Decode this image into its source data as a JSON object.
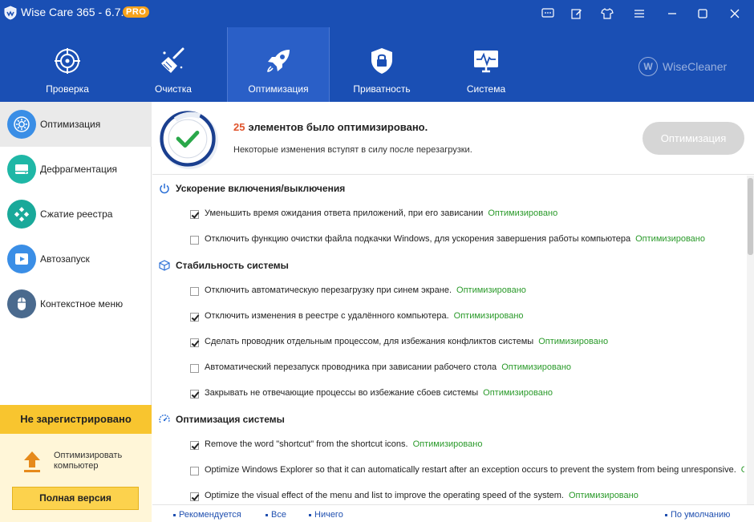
{
  "titlebar": {
    "title": "Wise Care 365 - 6.7.2",
    "badge": "PRO",
    "icons": [
      "feedback-icon",
      "edit-icon",
      "skin-icon",
      "menu-icon",
      "minimize-icon",
      "maximize-icon",
      "close-icon"
    ]
  },
  "nav": {
    "items": [
      {
        "label": "Проверка",
        "icon": "target-icon"
      },
      {
        "label": "Очистка",
        "icon": "broom-icon"
      },
      {
        "label": "Оптимизация",
        "icon": "rocket-icon",
        "active": true
      },
      {
        "label": "Приватность",
        "icon": "shield-lock-icon"
      },
      {
        "label": "Система",
        "icon": "monitor-pulse-icon"
      }
    ],
    "brand": "WiseCleaner"
  },
  "sidebar": {
    "items": [
      {
        "label": "Оптимизация",
        "icon": "gear-icon",
        "color": "#3a8ee6",
        "active": true
      },
      {
        "label": "Дефрагментация",
        "icon": "disk-icon",
        "color": "#1fb7a6"
      },
      {
        "label": "Сжатие реестра",
        "icon": "registry-icon",
        "color": "#19a99a"
      },
      {
        "label": "Автозапуск",
        "icon": "play-icon",
        "color": "#3a8ee6"
      },
      {
        "label": "Контекстное меню",
        "icon": "mouse-icon",
        "color": "#4a6a8e"
      }
    ],
    "register_title": "Не зарегистрировано",
    "upgrade_text": "Оптимизировать компьютер",
    "full_version_label": "Полная версия"
  },
  "status": {
    "count": "25",
    "title_rest": "элементов было оптимизировано.",
    "subtitle": "Некоторые изменения вступят в силу после перезагрузки.",
    "optimize_button": "Оптимизация"
  },
  "sections": [
    {
      "title": "Ускорение включения/выключения",
      "icon": "power-icon",
      "items": [
        {
          "text": "Уменьшить время ожидания ответа приложений, при его зависании",
          "checked": true,
          "status": "Оптимизировано"
        },
        {
          "text": "Отключить функцию очистки файла подкачки Windows, для ускорения завершения работы компьютера",
          "checked": false,
          "status": "Оптимизировано"
        }
      ]
    },
    {
      "title": "Стабильность системы",
      "icon": "cube-icon",
      "items": [
        {
          "text": "Отключить автоматическую перезагрузку при синем экране.",
          "checked": false,
          "status": "Оптимизировано"
        },
        {
          "text": "Отключить изменения в реестре с удалённого компьютера.",
          "checked": true,
          "status": "Оптимизировано"
        },
        {
          "text": "Сделать проводник отдельным процессом, для избежания конфликтов системы",
          "checked": true,
          "status": "Оптимизировано"
        },
        {
          "text": "Автоматический перезапуск проводника при зависании рабочего стола",
          "checked": false,
          "status": "Оптимизировано"
        },
        {
          "text": "Закрывать не отвечающие процессы во избежание сбоев системы",
          "checked": true,
          "status": "Оптимизировано"
        }
      ]
    },
    {
      "title": "Оптимизация системы",
      "icon": "speed-icon",
      "items": [
        {
          "text": "Remove the word \"shortcut\" from the shortcut icons.",
          "checked": true,
          "status": "Оптимизировано"
        },
        {
          "text": "Optimize Windows Explorer so that it can automatically restart after an exception occurs to prevent the system from being unresponsive.",
          "checked": false,
          "status": "О"
        },
        {
          "text": "Optimize the visual effect of the menu and list to improve the operating speed of the system.",
          "checked": true,
          "status": "Оптимизировано"
        }
      ]
    }
  ],
  "footer": {
    "recommended": "Рекомендуется",
    "all": "Все",
    "none": "Ничего",
    "default": "По умолчанию"
  },
  "colors": {
    "header": "#1a4fb4",
    "accent_orange": "#e0542c",
    "status_green": "#2a9a2a",
    "register_yellow": "#f8c52f"
  }
}
